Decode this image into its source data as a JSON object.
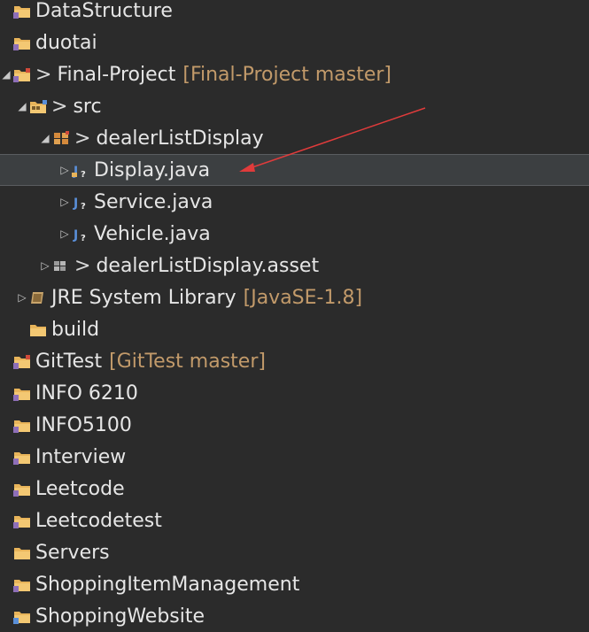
{
  "tree": {
    "dirty_prefix": ">",
    "items": [
      {
        "label": "DataStructure",
        "icon": "project-folder-icon"
      },
      {
        "label": "duotai",
        "icon": "project-folder-icon"
      },
      {
        "label": "Final-Project",
        "decoration": "[Final-Project master]",
        "icon": "git-project-icon",
        "expanded": true
      },
      {
        "label": "src",
        "icon": "source-folder-icon",
        "expanded": true
      },
      {
        "label": "dealerListDisplay",
        "icon": "package-icon",
        "expanded": true
      },
      {
        "label": "Display.java",
        "icon": "java-file-icon",
        "selected": true
      },
      {
        "label": "Service.java",
        "icon": "java-file-icon"
      },
      {
        "label": "Vehicle.java",
        "icon": "java-file-icon"
      },
      {
        "label": "dealerListDisplay.asset",
        "icon": "package-icon"
      },
      {
        "label": "JRE System Library",
        "decoration": "[JavaSE-1.8]",
        "icon": "library-icon"
      },
      {
        "label": "build",
        "icon": "folder-icon"
      },
      {
        "label": "GitTest",
        "decoration": "[GitTest master]",
        "icon": "git-project-icon"
      },
      {
        "label": "INFO 6210",
        "icon": "project-folder-icon"
      },
      {
        "label": "INFO5100",
        "icon": "project-folder-icon"
      },
      {
        "label": "Interview",
        "icon": "project-folder-icon"
      },
      {
        "label": "Leetcode",
        "icon": "project-folder-icon"
      },
      {
        "label": "Leetcodetest",
        "icon": "project-folder-icon"
      },
      {
        "label": "Servers",
        "icon": "project-folder-icon"
      },
      {
        "label": "ShoppingItemManagement",
        "icon": "project-folder-icon"
      },
      {
        "label": "ShoppingWebsite",
        "icon": "project-folder-icon"
      }
    ]
  },
  "annotation": {
    "color": "#e03b3b",
    "points_to": "Display.java"
  },
  "colors": {
    "background": "#2b2b2b",
    "text": "#e6e6e6",
    "decoration": "#c29a6a",
    "selection": "#3c3f41",
    "folder": "#e8b45a"
  }
}
